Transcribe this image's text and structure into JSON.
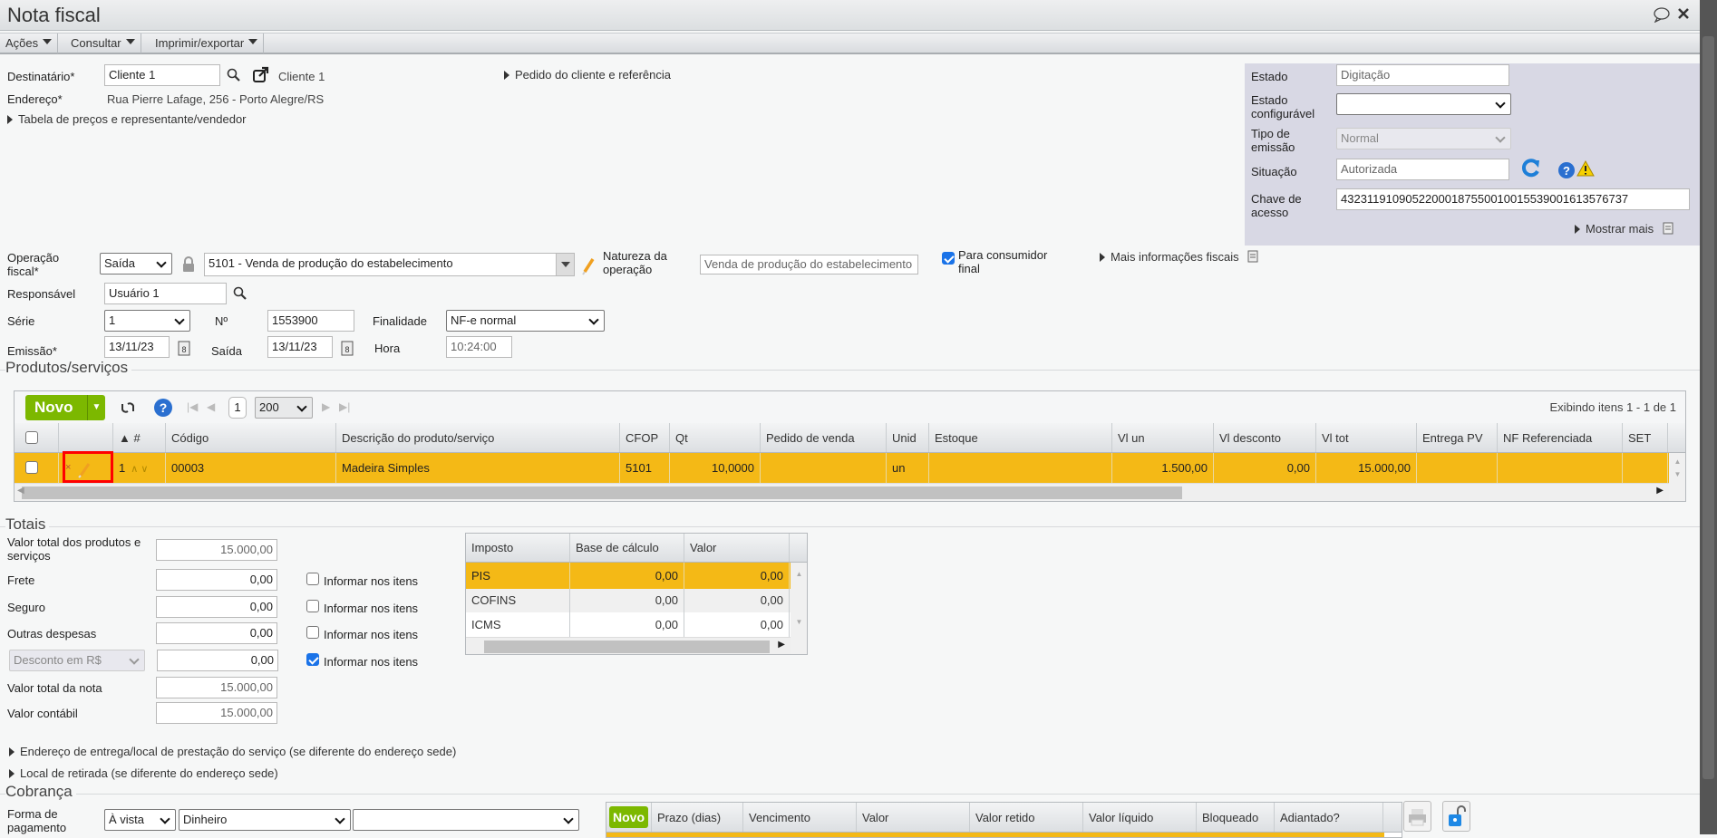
{
  "window": {
    "title": "Nota fiscal",
    "icons": [
      "comment-icon",
      "close-icon"
    ]
  },
  "menu": [
    {
      "label": "Ações"
    },
    {
      "label": "Consultar"
    },
    {
      "label": "Imprimir/exportar"
    }
  ],
  "header": {
    "destinatario_label": "Destinatário*",
    "destinatario_value": "Cliente 1",
    "destinatario_link": "Cliente 1",
    "endereco_label": "Endereço*",
    "endereco_value": "Rua Pierre Lafage, 256 - Porto Alegre/RS",
    "tabela_precos": "Tabela de preços e representante/vendedor",
    "pedido_cliente": "Pedido do cliente e referência"
  },
  "status_panel": {
    "estado_label": "Estado",
    "estado_value": "Digitação",
    "estado_config_label": "Estado configurável",
    "estado_config_value": "",
    "tipo_emissao_label": "Tipo de emissão",
    "tipo_emissao_value": "Normal",
    "situacao_label": "Situação",
    "situacao_value": "Autorizada",
    "chave_label": "Chave de acesso",
    "chave_value": "43231191090522000187550010015539001613576737",
    "mostrar_mais": "Mostrar mais"
  },
  "fiscal": {
    "operacao_label": "Operação fiscal*",
    "operacao_value": "Saída",
    "cfop_value": "5101 - Venda de produção do estabelecimento",
    "natureza_label": "Natureza da operação",
    "natureza_value": "Venda de produção do estabelecimento",
    "consumidor_final_label": "Para consumidor final",
    "consumidor_final_checked": true,
    "mais_info": "Mais informações fiscais",
    "responsavel_label": "Responsável",
    "responsavel_value": "Usuário 1",
    "serie_label": "Série",
    "serie_value": "1",
    "numero_label": "Nº",
    "numero_value": "1553900",
    "finalidade_label": "Finalidade",
    "finalidade_value": "NF-e normal",
    "emissao_label": "Emissão*",
    "emissao_value": "13/11/23",
    "saida_label": "Saída",
    "saida_value": "13/11/23",
    "hora_label": "Hora",
    "hora_value": "10:24:00"
  },
  "products": {
    "section_title": "Produtos/serviços",
    "new_button": "Novo",
    "page": "1",
    "page_size": "200",
    "showing": "Exibindo itens 1 - 1 de 1",
    "columns": [
      "",
      "",
      "▲ #",
      "Código",
      "Descrição do produto/serviço",
      "CFOP",
      "Qt",
      "Pedido de venda",
      "Unid",
      "Estoque",
      "Vl un",
      "Vl desconto",
      "Vl tot",
      "Entrega PV",
      "NF Referenciada",
      "SET"
    ],
    "rows": [
      [
        "",
        "",
        "1",
        "00003",
        "Madeira Simples",
        "5101",
        "10,0000",
        "",
        "un",
        "",
        "1.500,00",
        "0,00",
        "15.000,00",
        "",
        "",
        ""
      ]
    ],
    "selected_row_color": "#f4b916",
    "highlight_color": "#ff0000"
  },
  "totals": {
    "section_title": "Totais",
    "fields": [
      {
        "label": "Valor total dos produtos e serviços",
        "value": "15.000,00"
      },
      {
        "label": "Frete",
        "value": "0,00",
        "informar": "Informar nos itens",
        "checked": false
      },
      {
        "label": "Seguro",
        "value": "0,00",
        "informar": "Informar nos itens",
        "checked": false
      },
      {
        "label": "Outras despesas",
        "value": "0,00",
        "informar": "Informar nos itens",
        "checked": false
      },
      {
        "label": "Desconto em R$",
        "value": "0,00",
        "informar": "Informar nos itens",
        "checked": true
      },
      {
        "label": "Valor total da nota",
        "value": "15.000,00"
      },
      {
        "label": "Valor contábil",
        "value": "15.000,00"
      }
    ],
    "tax_columns": [
      "Imposto",
      "Base de cálculo",
      "Valor"
    ],
    "tax_rows": [
      [
        "PIS",
        "0,00",
        "0,00"
      ],
      [
        "COFINS",
        "0,00",
        "0,00"
      ],
      [
        "ICMS",
        "0,00",
        "0,00"
      ]
    ]
  },
  "links": {
    "entrega": "Endereço de entrega/local de prestação do serviço (se diferente do endereço sede)",
    "retirada": "Local de retirada (se diferente do endereço sede)"
  },
  "cobranca": {
    "section_title": "Cobrança",
    "forma_label": "Forma de pagamento",
    "prazo_value": "À vista",
    "meio_value": "Dinheiro",
    "extra_value": "",
    "new_button": "Novo",
    "columns": [
      "Prazo (dias)",
      "Vencimento",
      "Valor",
      "Valor retido",
      "Valor líquido",
      "Bloqueado",
      "Adiantado?"
    ]
  },
  "colors": {
    "accent_green": "#7cb800",
    "selected": "#f4b916",
    "panel": "#d8d8e4",
    "checkbox": "#1a73e8"
  }
}
